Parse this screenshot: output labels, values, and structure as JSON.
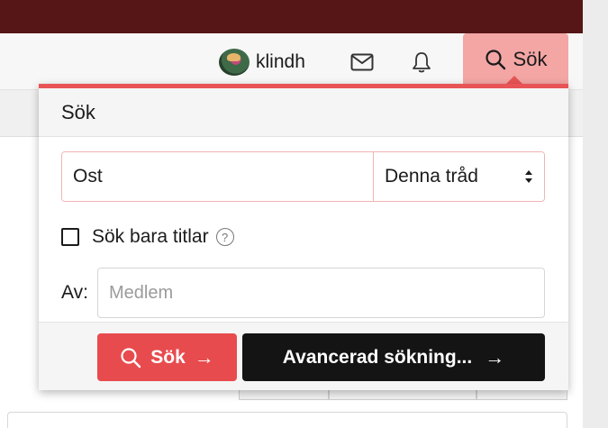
{
  "colors": {
    "topbar": "#561516",
    "accent": "#e84b4e",
    "search_tab": "#f3a6a4",
    "advanced_button": "#141414"
  },
  "navbar": {
    "username": "klindh",
    "avatar_icon": "user-avatar",
    "inbox_icon": "envelope-icon",
    "alerts_icon": "bell-icon",
    "search_label": "Sök"
  },
  "search_popup": {
    "title": "Sök",
    "query_value": "Ost",
    "scope_selected": "Denna tråd",
    "titles_only_label": "Sök bara titlar",
    "titles_only_checked": false,
    "help_glyph": "?",
    "member_label": "Av:",
    "member_placeholder": "Medlem",
    "search_button": "Sök",
    "search_button_arrow": "→",
    "advanced_button": "Avancerad sökning...",
    "advanced_button_arrow": "→"
  }
}
